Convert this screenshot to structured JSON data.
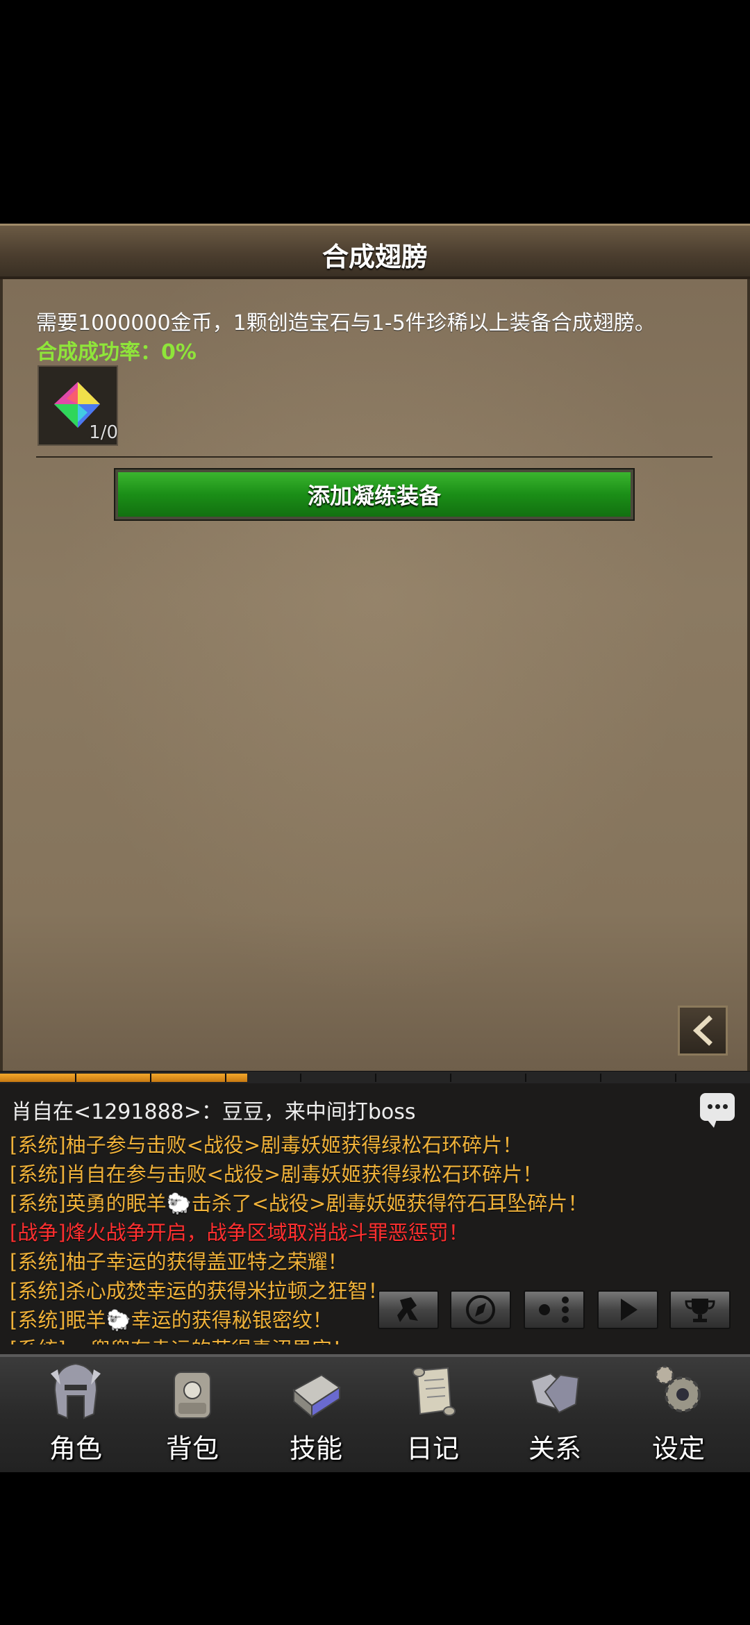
{
  "header": {
    "title": "合成翅膀"
  },
  "main": {
    "description": "需要1000000金币，1颗创造宝石与1-5件珍稀以上装备合成翅膀。",
    "success_rate": "合成成功率：0%",
    "gem_count": "1/0",
    "add_button": "添加凝练装备"
  },
  "progress": {
    "filled_fraction": 0.33
  },
  "chat": {
    "header": "肖自在<1291888>：豆豆，来中间打boss",
    "messages": [
      {
        "type": "system",
        "text": "[系统]柚子参与击败<战役>剧毒妖姬获得绿松石环碎片！"
      },
      {
        "type": "system",
        "text": "[系统]肖自在参与击败<战役>剧毒妖姬获得绿松石环碎片！"
      },
      {
        "type": "system",
        "text": "[系统]英勇的眠羊🐑击杀了<战役>剧毒妖姬获得符石耳坠碎片！"
      },
      {
        "type": "war",
        "text": "[战争]烽火战争开启，战争区域取消战斗罪恶惩罚！"
      },
      {
        "type": "system",
        "text": "[系统]柚子幸运的获得盖亚特之荣耀！"
      },
      {
        "type": "system",
        "text": "[系统]杀心成焚幸运的获得米拉顿之狂智！"
      },
      {
        "type": "system",
        "text": "[系统]眠羊🐑幸运的获得秘银密纹！"
      },
      {
        "type": "system",
        "text": "[系统]oo兜兜有幸运的获得毒沼果实！"
      }
    ]
  },
  "nav": {
    "items": [
      {
        "label": "角色",
        "icon": "helmet-icon"
      },
      {
        "label": "背包",
        "icon": "backpack-icon"
      },
      {
        "label": "技能",
        "icon": "skill-book-icon"
      },
      {
        "label": "日记",
        "icon": "scroll-icon"
      },
      {
        "label": "关系",
        "icon": "handshake-icon"
      },
      {
        "label": "设定",
        "icon": "gear-icon"
      }
    ]
  },
  "colors": {
    "system_text": "#f0b23a",
    "war_text": "#ff3030",
    "success_rate": "#8fe53a",
    "button_green": "#1b8e17"
  }
}
